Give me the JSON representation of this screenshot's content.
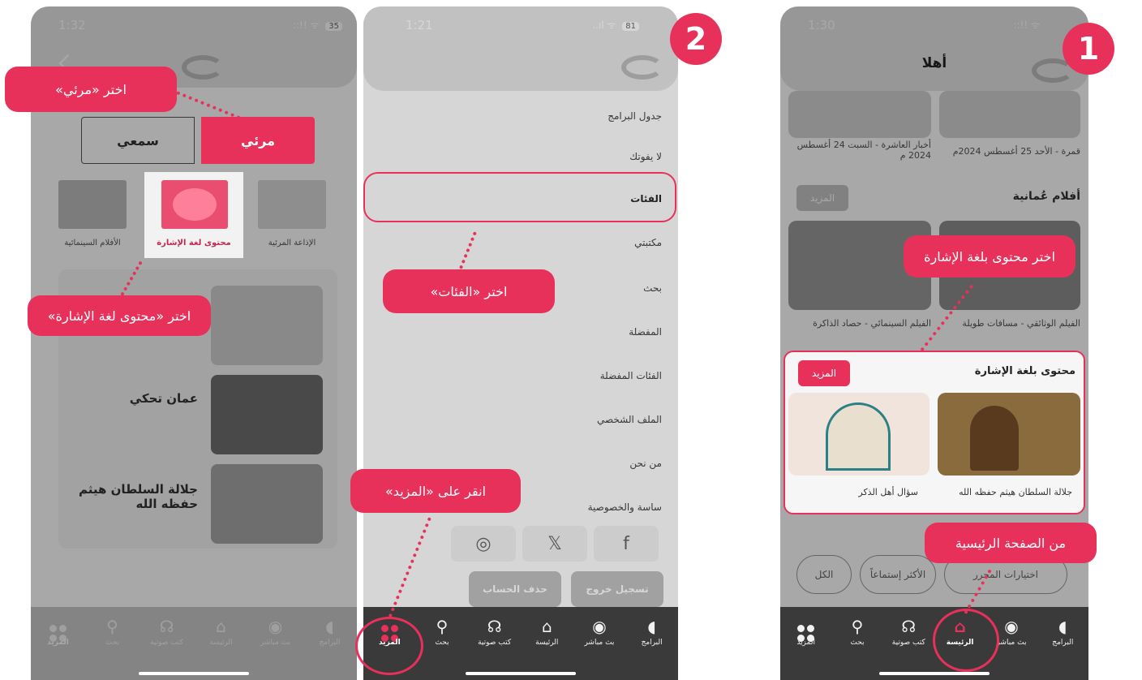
{
  "colors": {
    "accent": "#e8315a",
    "dim": "#000000"
  },
  "phone_a": {
    "status": {
      "time": "1:32",
      "signal": "::!! ᯤ",
      "battery": "35"
    },
    "segment": {
      "visual": "مرئي",
      "audio": "سمعي"
    },
    "categories": [
      {
        "label": "الإذاعة المرئية"
      },
      {
        "label": "محتوى لغة الإشارة"
      },
      {
        "label": "الأفلام السينمائية"
      }
    ],
    "list": [
      {
        "title": ""
      },
      {
        "title": "عمان تحكي"
      },
      {
        "title": "جلالة السلطان هيثم حفظه الله"
      }
    ],
    "tooltips": {
      "choose_visual": "اختر «مرئي»",
      "choose_sign": "اختر «محتوى لغة الإشارة»"
    }
  },
  "phone_b": {
    "status": {
      "time": "1:21",
      "signal": "..ıl ᯤ",
      "battery": "81"
    },
    "step": "2",
    "menu": [
      "جدول البرامج",
      "لا يفوتك",
      "الفئات",
      "مكتبتي",
      "بحث",
      "المفضلة",
      "الفئات المفضلة",
      "الملف الشخصي",
      "من نحن",
      "ساسة والخصوصية"
    ],
    "actions": {
      "logout": "تسجيل خروج",
      "delete": "حذف الحساب"
    },
    "tooltips": {
      "choose_categories": "اختر «الفئات»",
      "tap_more": "انقر على «المزيد»"
    }
  },
  "phone_c": {
    "status": {
      "time": "1:30",
      "signal": "::!! ᯤ"
    },
    "step": "1",
    "title": "أهلا",
    "top_items": [
      "قمرة - الأحد 25 أغسطس 2024م",
      "أخبار العاشرة - السبت 24 أغسطس 2024 م"
    ],
    "films_section": {
      "title": "أفلام عُمانية",
      "more": "المزيد",
      "items": [
        "الفيلم الوثائقي - مسافات طويلة",
        "الفيلم السينمائي - حصاد الذاكرة"
      ]
    },
    "sign_section": {
      "title": "محتوى بلغة الإشارة",
      "more": "المزيد",
      "items": [
        "جلالة السلطان هيثم حفظه الله",
        "سؤال أهل الذكر"
      ]
    },
    "chips": [
      "اختيارات المحرر",
      "الأكثر إستماعاً",
      "الكل"
    ],
    "tooltips": {
      "choose_sign_content": "اختر محتوى بلغة الإشارة",
      "from_home": "من الصفحة الرئيسية"
    }
  },
  "nav": {
    "programs": "البرامج",
    "live": "بث مباشر",
    "home": "الرئيسة",
    "home_bold": "الرئيسة",
    "audiobooks": "كتب صوتية",
    "search": "بحث",
    "more": "المزيد"
  }
}
